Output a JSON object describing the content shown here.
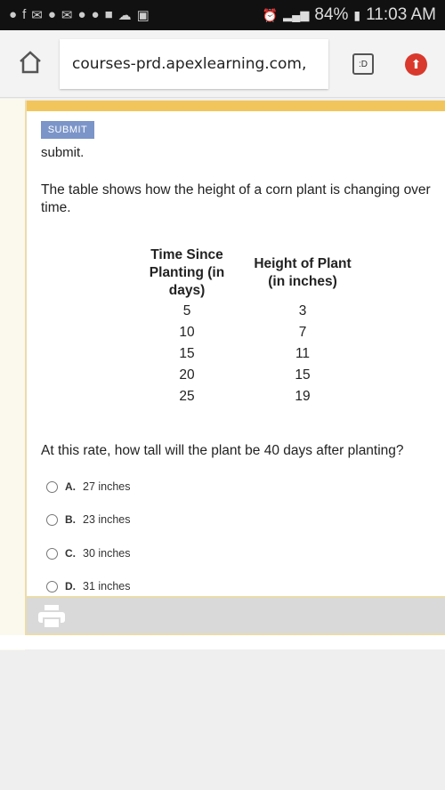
{
  "status_bar": {
    "battery": "84%",
    "time": "11:03 AM"
  },
  "browser": {
    "url": "courses-prd.apexlearning.com,",
    "tab_label": ":D"
  },
  "content": {
    "submit_label": "SUBMIT",
    "cut_text": "submit.",
    "intro": "The table shows how the height of a corn plant is changing over time.",
    "table": {
      "headers": [
        "Time Since Planting (in days)",
        "Height of Plant (in inches)"
      ],
      "rows": [
        [
          "5",
          "3"
        ],
        [
          "10",
          "7"
        ],
        [
          "15",
          "11"
        ],
        [
          "20",
          "15"
        ],
        [
          "25",
          "19"
        ]
      ]
    },
    "question": "At this rate, how tall will the plant be 40 days after planting?",
    "options": [
      {
        "letter": "A.",
        "text": "27 inches"
      },
      {
        "letter": "B.",
        "text": "23 inches"
      },
      {
        "letter": "C.",
        "text": "30 inches"
      },
      {
        "letter": "D.",
        "text": "31 inches"
      }
    ]
  },
  "colors": {
    "accent": "#f2c55c",
    "submit": "#7b95c9",
    "update": "#d9392c"
  }
}
